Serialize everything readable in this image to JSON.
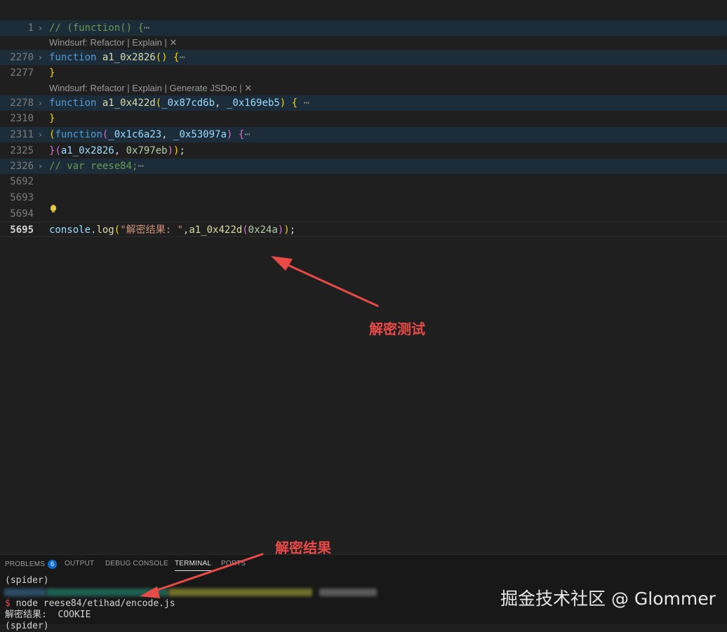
{
  "editor": {
    "line_numbers": [
      "1",
      "2270",
      "2277",
      "2278",
      "2310",
      "2311",
      "2325",
      "2326",
      "5692",
      "5693",
      "5694",
      "5695"
    ],
    "codelens": [
      {
        "prefix": "Windsurf: ",
        "actions": [
          "Refactor",
          "Explain"
        ],
        "close": "✕"
      },
      {
        "prefix": "Windsurf: ",
        "actions": [
          "Refactor",
          "Explain",
          "Generate JSDoc"
        ],
        "close": "✕"
      }
    ],
    "code": {
      "l1": "// (function() {",
      "l2270_kw": "function",
      "l2270_name": "a1_0x2826",
      "l2278_kw": "function",
      "l2278_name": "a1_0x422d",
      "l2278_p1": "_0x87cd6b",
      "l2278_p2": "_0x169eb5",
      "l2311_kw": "function",
      "l2311_p1": "_0x1c6a23",
      "l2311_p2": "_0x53097a",
      "l2325_arg1": "a1_0x2826",
      "l2325_arg2": "0x797eb",
      "l2326": "// var reese84;",
      "l5695_obj": "console",
      "l5695_method": "log",
      "l5695_str": "\"解密结果: \"",
      "l5695_fn": "a1_0x422d",
      "l5695_arg": "0x24a"
    },
    "fold_ellipsis": "⋯"
  },
  "annotations": {
    "editor_note": "解密测试",
    "terminal_note": "解密结果"
  },
  "panel": {
    "tabs": [
      {
        "label": "PROBLEMS",
        "badge": "6"
      },
      {
        "label": "OUTPUT"
      },
      {
        "label": "DEBUG CONSOLE"
      },
      {
        "label": "TERMINAL",
        "active": true
      },
      {
        "label": "PORTS"
      }
    ],
    "terminal": {
      "env_line": "(spider)",
      "prompt_symbol": "$",
      "command": " node reese84/etihad/encode.js",
      "output": "解密结果:  COOKIE",
      "next_line": "(spider)"
    }
  },
  "watermark": "掘金技术社区 @ Glommer",
  "colors": {
    "background": "#1f1f1f",
    "folded_line_bg": "#1c2c38",
    "annotation_red": "#e84a47",
    "keyword_blue": "#569cd6",
    "function_yellow": "#dcdcaa",
    "string_orange": "#ce9178",
    "comment_green": "#6a9955"
  }
}
